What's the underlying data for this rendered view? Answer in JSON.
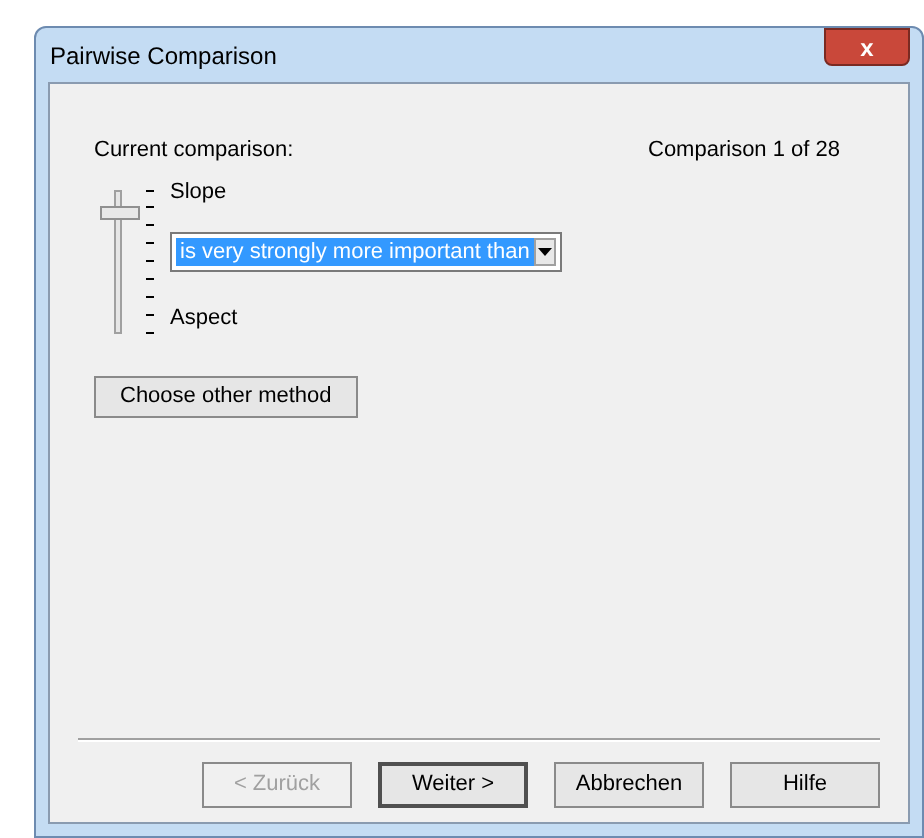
{
  "window": {
    "title": "Pairwise Comparison",
    "close": "x"
  },
  "current_label": "Current comparison:",
  "counter": "Comparison 1 of 28",
  "slider": {
    "top_label": "Slope",
    "bottom_label": "Aspect",
    "level": 0.875
  },
  "dropdown": {
    "value": "is very strongly more important than"
  },
  "method_button": "Choose other method",
  "buttons": [
    {
      "label": "< Zurück",
      "disabled": true,
      "default": false
    },
    {
      "label": "Weiter >",
      "disabled": false,
      "default": true
    },
    {
      "label": "Abbrechen",
      "disabled": false,
      "default": false
    },
    {
      "label": "Hilfe",
      "disabled": false,
      "default": false
    }
  ]
}
